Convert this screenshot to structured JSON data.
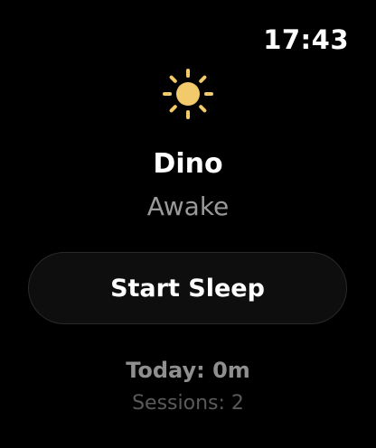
{
  "status_bar": {
    "time": "17:43"
  },
  "pet": {
    "state_icon": "sun-icon",
    "name": "Dino",
    "status": "Awake"
  },
  "actions": {
    "start_sleep_label": "Start Sleep"
  },
  "stats": {
    "today": "Today: 0m",
    "sessions": "Sessions: 2"
  },
  "colors": {
    "background": "#000000",
    "sun": "#f2c96b",
    "button_bg": "#0e0e0e",
    "secondary_text": "#9a9a9a"
  }
}
